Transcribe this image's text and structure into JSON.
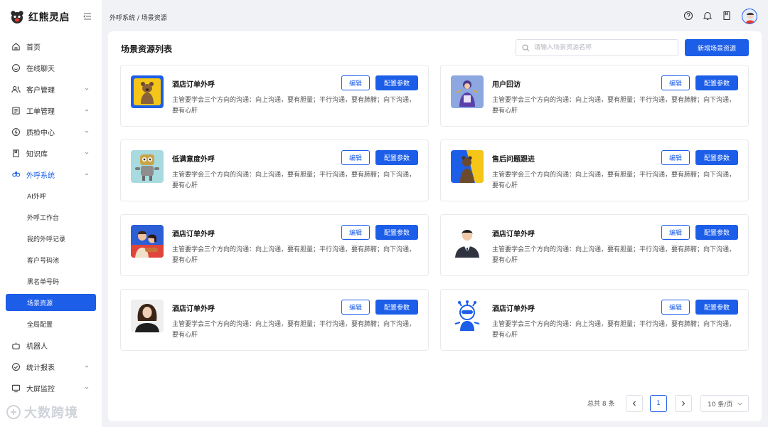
{
  "app": {
    "logo_text": "红熊灵启"
  },
  "sidebar": {
    "items": [
      {
        "label": "首页",
        "icon": "home-icon"
      },
      {
        "label": "在线聊天",
        "icon": "chat-icon"
      },
      {
        "label": "客户管理",
        "icon": "users-icon"
      },
      {
        "label": "工单管理",
        "icon": "ticket-icon"
      },
      {
        "label": "质检中心",
        "icon": "quality-icon"
      },
      {
        "label": "知识库",
        "icon": "book-icon"
      },
      {
        "label": "外呼系统",
        "icon": "outbound-icon"
      }
    ],
    "sub_items": [
      {
        "label": "AI外呼"
      },
      {
        "label": "外呼工作台"
      },
      {
        "label": "我的外呼记录"
      },
      {
        "label": "客户号码池"
      },
      {
        "label": "黑名单号码"
      },
      {
        "label": "场景资源"
      },
      {
        "label": "全局配置"
      }
    ],
    "bottom_items": [
      {
        "label": "机器人",
        "icon": "robot-icon"
      },
      {
        "label": "统计报表",
        "icon": "stats-icon"
      },
      {
        "label": "大屏监控",
        "icon": "monitor-icon"
      }
    ],
    "watermark": "大数跨境"
  },
  "topbar": {
    "breadcrumb": "外呼系统 / 场景资源"
  },
  "main": {
    "title": "场景资源列表",
    "search_placeholder": "请输入场景资源名称",
    "add_button": "新增场景资源",
    "cards": [
      {
        "title": "酒店订单外呼",
        "desc": "主管要学会三个方向的沟通：向上沟通，要有胆量；平行沟通，要有肺腑；向下沟通，要有心肝",
        "edit": "编辑",
        "config": "配置参数"
      },
      {
        "title": "用户回访",
        "desc": "主管要学会三个方向的沟通：向上沟通，要有胆量；平行沟通，要有肺腑；向下沟通，要有心肝",
        "edit": "编辑",
        "config": "配置参数"
      },
      {
        "title": "低满意度外呼",
        "desc": "主管要学会三个方向的沟通：向上沟通，要有胆量；平行沟通，要有肺腑；向下沟通，要有心肝",
        "edit": "编辑",
        "config": "配置参数"
      },
      {
        "title": "售后问题跟进",
        "desc": "主管要学会三个方向的沟通：向上沟通，要有胆量；平行沟通，要有肺腑；向下沟通，要有心肝",
        "edit": "编辑",
        "config": "配置参数"
      },
      {
        "title": "酒店订单外呼",
        "desc": "主管要学会三个方向的沟通：向上沟通，要有胆量；平行沟通，要有肺腑；向下沟通，要有心肝",
        "edit": "编辑",
        "config": "配置参数"
      },
      {
        "title": "酒店订单外呼",
        "desc": "主管要学会三个方向的沟通：向上沟通，要有胆量；平行沟通，要有肺腑；向下沟通，要有心肝",
        "edit": "编辑",
        "config": "配置参数"
      },
      {
        "title": "酒店订单外呼",
        "desc": "主管要学会三个方向的沟通：向上沟通，要有胆量；平行沟通，要有肺腑；向下沟通，要有心肝",
        "edit": "编辑",
        "config": "配置参数"
      },
      {
        "title": "酒店订单外呼",
        "desc": "主管要学会三个方向的沟通：向上沟通，要有胆量；平行沟通，要有肺腑；向下沟通，要有心肝",
        "edit": "编辑",
        "config": "配置参数"
      }
    ]
  },
  "pagination": {
    "total": "总共 8 条",
    "current_page": "1",
    "page_size": "10 条/页"
  },
  "colors": {
    "accent": "#1d5ee8"
  }
}
